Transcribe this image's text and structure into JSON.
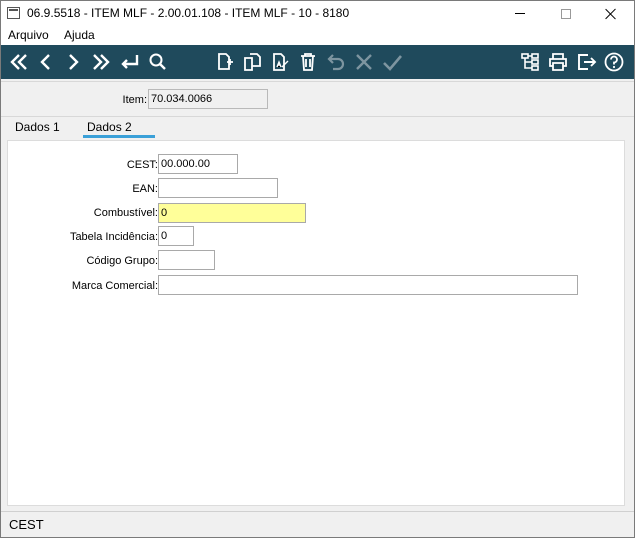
{
  "window": {
    "title": "06.9.5518 - ITEM MLF - 2.00.01.108 - ITEM MLF - 10 - 8180"
  },
  "menu": {
    "items": [
      "Arquivo",
      "Ajuda"
    ]
  },
  "toolbar": {
    "color": "#1f4a5c",
    "icons": [
      "first-icon",
      "previous-icon",
      "next-icon",
      "last-icon",
      "return-icon",
      "search-icon",
      "new-document-icon",
      "copy-icon",
      "edit-icon",
      "delete-icon",
      "undo-icon",
      "cancel-icon",
      "confirm-icon",
      "tree-icon",
      "print-icon",
      "exit-icon",
      "help-icon"
    ]
  },
  "item": {
    "label": "Item:",
    "value": "70.034.0066"
  },
  "tabs": {
    "items": [
      "Dados 1",
      "Dados 2"
    ],
    "active": "Dados 2",
    "active_color": "#3aa0d8"
  },
  "form": {
    "cest": {
      "label": "CEST:",
      "value": "00.000.00"
    },
    "ean": {
      "label": "EAN:",
      "value": ""
    },
    "combustivel": {
      "label": "Combustível:",
      "value": "0",
      "highlight": "#ffff99"
    },
    "tabela_incidencia": {
      "label": "Tabela Incidência:",
      "value": "0"
    },
    "codigo_grupo": {
      "label": "Código Grupo:",
      "value": ""
    },
    "marca_comercial": {
      "label": "Marca Comercial:",
      "value": ""
    }
  },
  "status": {
    "text": "CEST"
  }
}
